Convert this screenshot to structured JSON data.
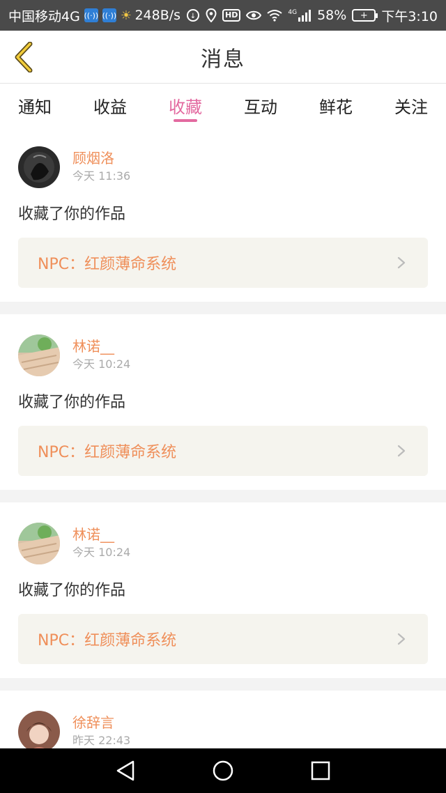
{
  "status_bar": {
    "carrier": "中国移动4G",
    "net_speed": "248B/s",
    "signal_label": "4G",
    "battery": "58%",
    "time": "下午3:10",
    "hd_label": "HD"
  },
  "header": {
    "title": "消息",
    "back_icon": "chevron-left-icon"
  },
  "tabs": [
    {
      "label": "通知",
      "active": false
    },
    {
      "label": "收益",
      "active": false
    },
    {
      "label": "收藏",
      "active": true
    },
    {
      "label": "互动",
      "active": false
    },
    {
      "label": "鲜花",
      "active": false
    },
    {
      "label": "关注",
      "active": false
    }
  ],
  "messages": [
    {
      "user": "顾烟洛",
      "time": "今天 11:36",
      "action": "收藏了你的作品",
      "work": "NPC：红颜薄命系统"
    },
    {
      "user": "林诺__",
      "time": "今天 10:24",
      "action": "收藏了你的作品",
      "work": "NPC：红颜薄命系统"
    },
    {
      "user": "林诺__",
      "time": "今天 10:24",
      "action": "收藏了你的作品",
      "work": "NPC：红颜薄命系统"
    },
    {
      "user": "徐辞言",
      "time": "昨天 22:43"
    }
  ],
  "colors": {
    "accent": "#e36aa0",
    "name": "#ef8f5a",
    "work_bg": "#f5f4ee"
  }
}
